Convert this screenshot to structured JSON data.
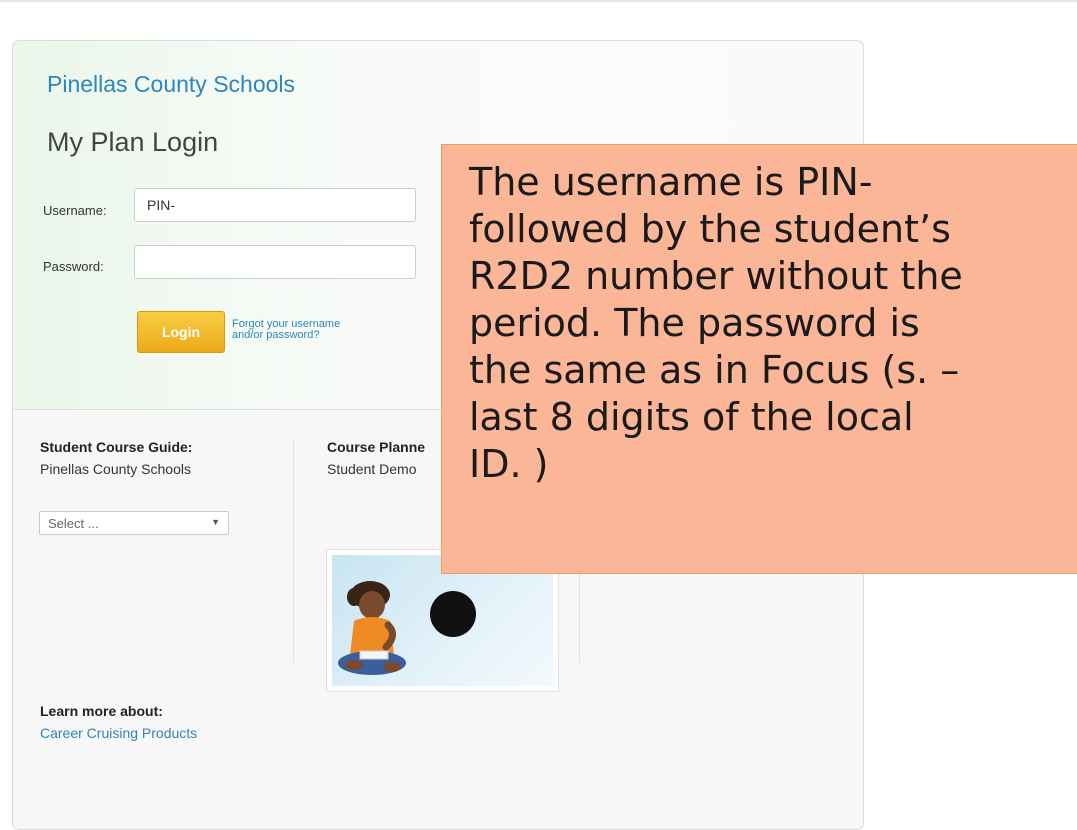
{
  "header": {
    "school_name": "Pinellas County Schools",
    "login_title": "My Plan Login"
  },
  "login_form": {
    "username_label": "Username:",
    "username_value": "PIN-",
    "password_label": "Password:",
    "password_value": "",
    "login_button": "Login",
    "forgot_link": "Forgot your username and/or password?"
  },
  "course_guide": {
    "title": "Student Course Guide:",
    "subtitle": "Pinellas County Schools",
    "select_value": "Select ..."
  },
  "course_planner": {
    "title": "Course Planne",
    "subtitle": "Student Demo"
  },
  "learn_more": {
    "title": "Learn more about:",
    "link": "Career Cruising Products"
  },
  "callout": {
    "text": "The username is PIN-\nfollowed by the student’s\nR2D2 number without the\nperiod. The password is\nthe same as in Focus (s. –\nlast 8 digits of the local\nID. )"
  },
  "colors": {
    "link_blue": "#2e86b8",
    "login_orange": "#eeaa1a",
    "callout_bg": "#fbb697",
    "callout_border": "#e8a05c"
  },
  "icons": {
    "play": "play-icon",
    "select_caret": "chevron-down-icon"
  }
}
